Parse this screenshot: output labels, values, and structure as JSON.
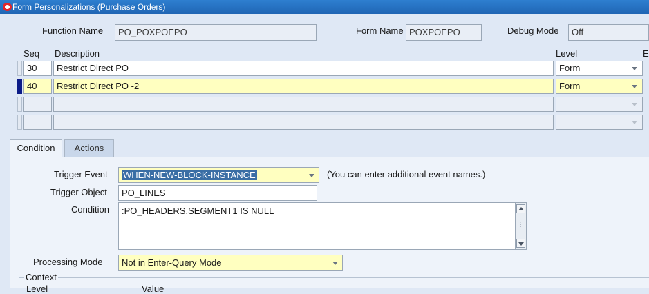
{
  "window": {
    "title": "Form Personalizations (Purchase Orders)"
  },
  "header": {
    "function_name_label": "Function Name",
    "function_name_value": "PO_POXPOEPO",
    "form_name_label": "Form Name",
    "form_name_value": "POXPOEPO",
    "debug_mode_label": "Debug Mode",
    "debug_mode_value": "Off"
  },
  "grid": {
    "col_seq": "Seq",
    "col_description": "Description",
    "col_level": "Level",
    "col_enabled_partial": "E",
    "rows": [
      {
        "seq": "30",
        "description": "Restrict Direct PO",
        "level": "Form"
      },
      {
        "seq": "40",
        "description": "Restrict Direct PO -2",
        "level": "Form"
      },
      {
        "seq": "",
        "description": "",
        "level": ""
      },
      {
        "seq": "",
        "description": "",
        "level": ""
      }
    ]
  },
  "tabs": [
    {
      "label": "Condition"
    },
    {
      "label": "Actions"
    }
  ],
  "condition": {
    "trigger_event_label": "Trigger Event",
    "trigger_event_value": "WHEN-NEW-BLOCK-INSTANCE",
    "trigger_event_hint": "(You can enter additional event names.)",
    "trigger_object_label": "Trigger Object",
    "trigger_object_value": "PO_LINES",
    "condition_label": "Condition",
    "condition_value": ":PO_HEADERS.SEGMENT1 IS NULL",
    "processing_mode_label": "Processing Mode",
    "processing_mode_value": "Not in Enter-Query Mode",
    "context_label": "Context",
    "context_col_level": "Level",
    "context_col_value": "Value"
  },
  "colors": {
    "title_bar": "#1f64b3",
    "selected_row": "#ffffc0",
    "active_row_marker": "#0b1b87",
    "background": "#dfe8f5"
  }
}
